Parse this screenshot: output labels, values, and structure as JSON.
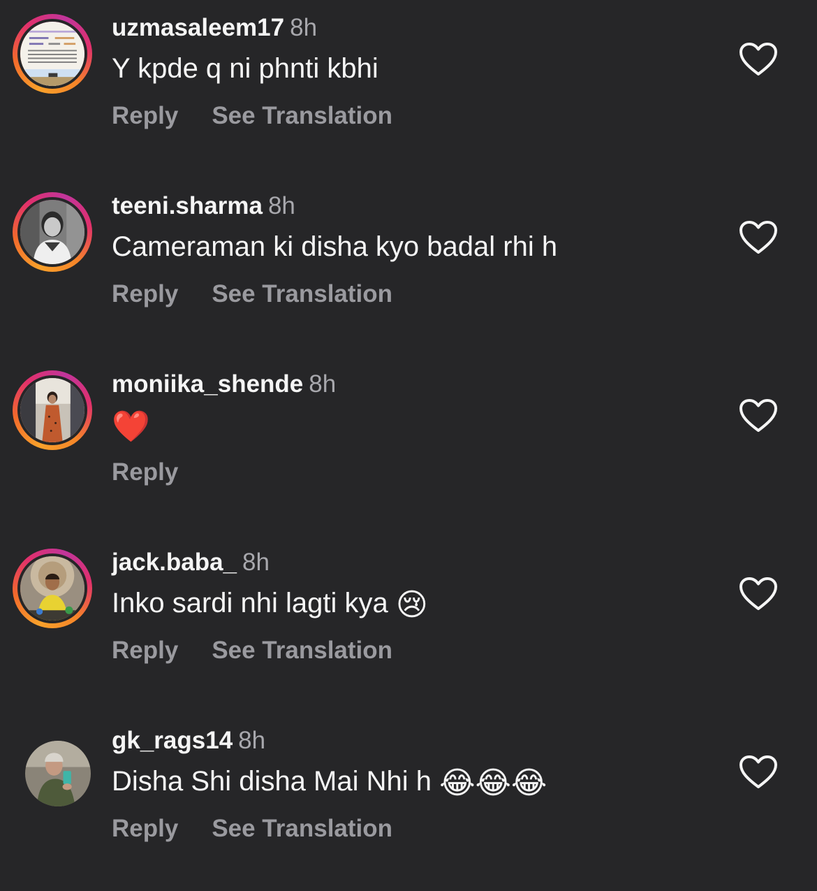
{
  "comments": [
    {
      "username": "uzmasaleem17",
      "time": "8h",
      "text": "Y kpde q ni phnti kbhi",
      "emoji": "",
      "reply_label": "Reply",
      "translate_label": "See Translation"
    },
    {
      "username": "teeni.sharma",
      "time": "8h",
      "text": "Cameraman ki disha kyo badal rhi h",
      "emoji": "",
      "reply_label": "Reply",
      "translate_label": "See Translation"
    },
    {
      "username": "moniika_shende",
      "time": "8h",
      "text": "",
      "emoji": "❤️",
      "reply_label": "Reply",
      "translate_label": ""
    },
    {
      "username": "jack.baba_",
      "time": "8h",
      "text": "Inko sardi nhi lagti kya ",
      "emoji": "😢",
      "reply_label": "Reply",
      "translate_label": "See Translation"
    },
    {
      "username": "gk_rags14",
      "time": "8h",
      "text": "Disha Shi disha Mai Nhi h ",
      "emoji": "😂😂😂",
      "reply_label": "Reply",
      "translate_label": "See Translation"
    }
  ],
  "icons": {
    "like": "heart-outline-icon"
  },
  "colors": {
    "background": "#262628",
    "text": "#f5f5f5",
    "muted": "#9a9a9f",
    "story_ring": [
      "#f9a12b",
      "#e1306c",
      "#c1359b"
    ]
  }
}
